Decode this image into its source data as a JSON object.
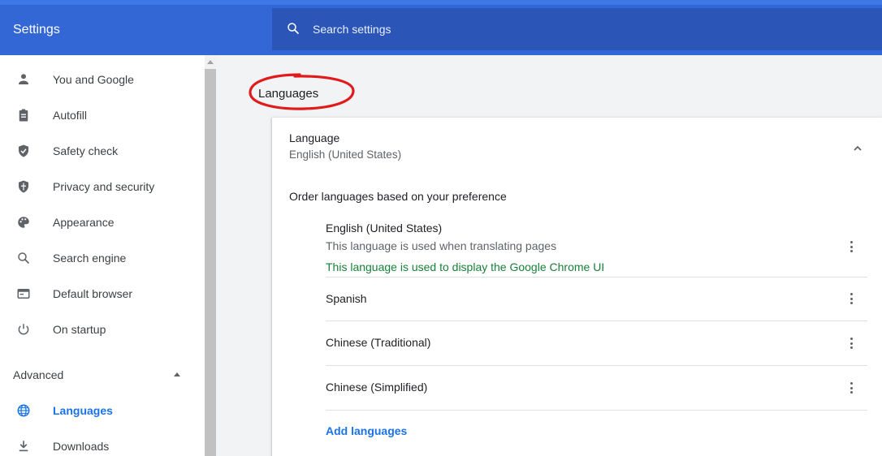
{
  "header": {
    "title": "Settings",
    "search_placeholder": "Search settings"
  },
  "sidebar": {
    "items": [
      {
        "label": "You and Google",
        "icon": "person-icon"
      },
      {
        "label": "Autofill",
        "icon": "clipboard-icon"
      },
      {
        "label": "Safety check",
        "icon": "shield-check-icon"
      },
      {
        "label": "Privacy and security",
        "icon": "shield-icon"
      },
      {
        "label": "Appearance",
        "icon": "palette-icon"
      },
      {
        "label": "Search engine",
        "icon": "search-icon"
      },
      {
        "label": "Default browser",
        "icon": "browser-icon"
      },
      {
        "label": "On startup",
        "icon": "power-icon"
      }
    ],
    "advanced_label": "Advanced",
    "advanced_items": [
      {
        "label": "Languages",
        "icon": "globe-icon",
        "active": true
      },
      {
        "label": "Downloads",
        "icon": "download-icon"
      }
    ]
  },
  "main": {
    "page_title": "Languages",
    "card": {
      "heading": "Language",
      "subheading": "English (United States)",
      "order_label": "Order languages based on your preference",
      "languages": [
        {
          "name": "English (United States)",
          "desc": "This language is used when translating pages",
          "desc2": "This language is used to display the Google Chrome UI"
        },
        {
          "name": "Spanish"
        },
        {
          "name": "Chinese (Traditional)"
        },
        {
          "name": "Chinese (Simplified)"
        }
      ],
      "add_label": "Add languages"
    }
  },
  "colors": {
    "header_bg": "#3367d6",
    "search_bg": "#2b56b8",
    "accent": "#1a73e8",
    "green_text": "#188038",
    "annotation_ring": "#e01b1b"
  }
}
